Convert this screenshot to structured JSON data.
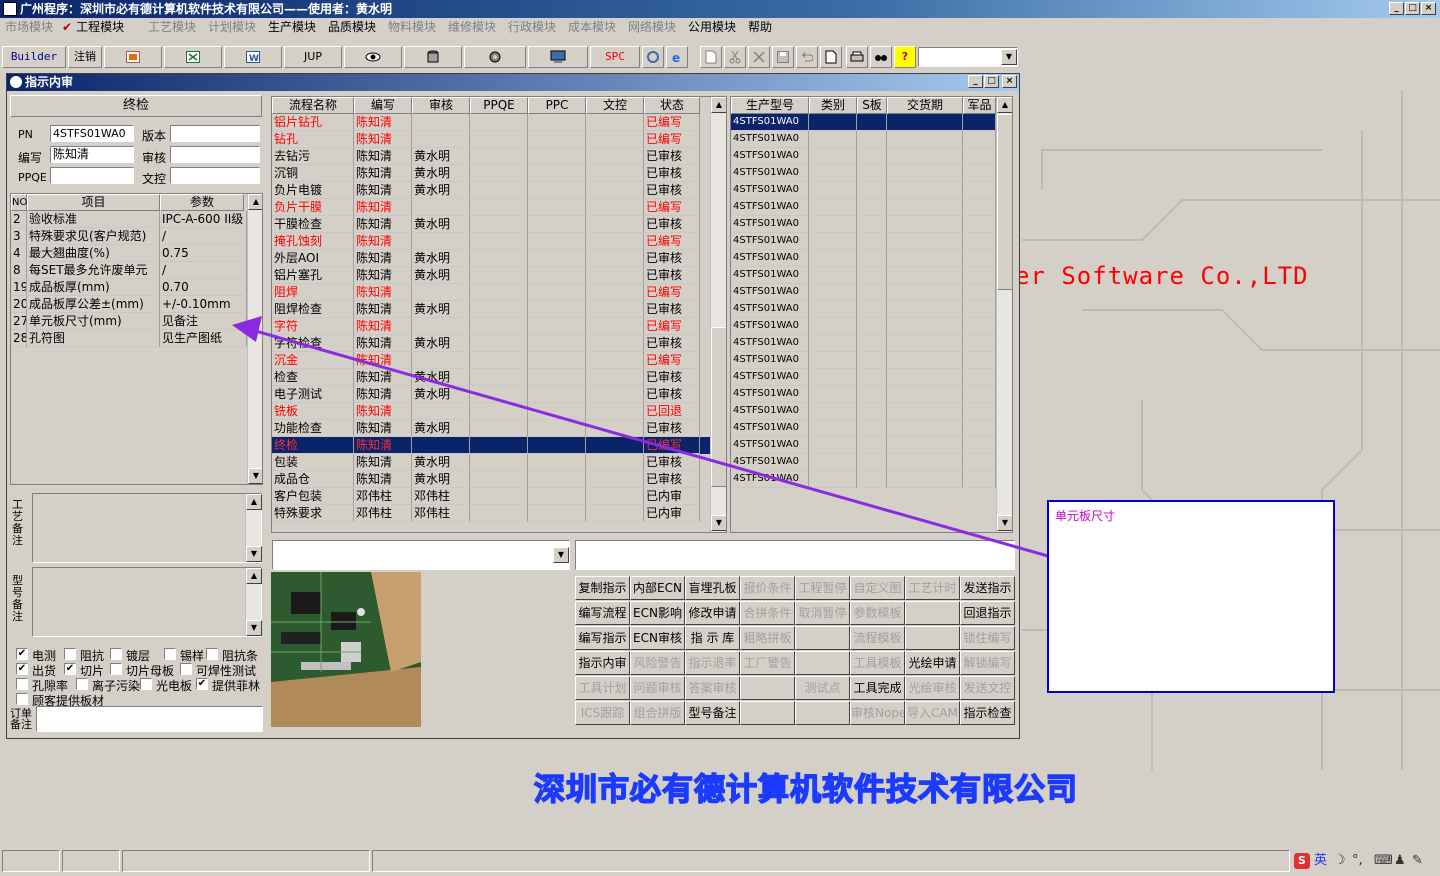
{
  "app": {
    "title": "广州程序：深圳市必有德计算机软件技术有限公司——使用者：黄水明"
  },
  "menu": [
    {
      "label": "市场模块",
      "enabled": false
    },
    {
      "label": "工程模块",
      "enabled": true,
      "checked": true
    },
    {
      "label": "工艺模块",
      "enabled": false
    },
    {
      "label": "计划模块",
      "enabled": false
    },
    {
      "label": "生产模块",
      "enabled": true
    },
    {
      "label": "品质模块",
      "enabled": true
    },
    {
      "label": "物料模块",
      "enabled": false
    },
    {
      "label": "维修模块",
      "enabled": false
    },
    {
      "label": "行政模块",
      "enabled": false
    },
    {
      "label": "成本模块",
      "enabled": false
    },
    {
      "label": "网络模块",
      "enabled": false
    },
    {
      "label": "公用模块",
      "enabled": true
    },
    {
      "label": "帮助",
      "enabled": true
    }
  ],
  "toolbar": {
    "builder": "Builder",
    "logout": "注销",
    "jup": "JUP",
    "spc": "SPC",
    "question": "?"
  },
  "child": {
    "title": "指示内审"
  },
  "left": {
    "section_title": "终检",
    "pn_label": "PN",
    "pn_value": "4STFS01WA0",
    "version_label": "版本",
    "version_value": "",
    "editor_label": "编写",
    "editor_value": "陈知清",
    "review_label": "审核",
    "review_value": "",
    "ppqe_label": "PPQE",
    "ppqe_value": "",
    "wk_label": "文控",
    "wk_value": "",
    "params_headers": {
      "no": "NO",
      "item": "项目",
      "param": "参数"
    },
    "params": [
      {
        "no": "2",
        "item": "验收标准",
        "param": "IPC-A-600 II级"
      },
      {
        "no": "3",
        "item": "特殊要求见(客户规范)",
        "param": "/"
      },
      {
        "no": "4",
        "item": "最大翘曲度(%)",
        "param": "0.75"
      },
      {
        "no": "8",
        "item": "每SET最多允许废单元",
        "param": "/"
      },
      {
        "no": "19",
        "item": "成品板厚(mm)",
        "param": "0.70"
      },
      {
        "no": "20",
        "item": "成品板厚公差±(mm)",
        "param": "+/-0.10mm"
      },
      {
        "no": "27",
        "item": "单元板尺寸(mm)",
        "param": "见备注"
      },
      {
        "no": "28",
        "item": "孔符图",
        "param": "见生产图纸"
      }
    ],
    "craft_note_label": "工艺备注",
    "model_note_label": "型号备注",
    "order_note_label": "订单备注",
    "checks": [
      {
        "label": "电测",
        "checked": true
      },
      {
        "label": "阻抗",
        "checked": false
      },
      {
        "label": "镀层",
        "checked": false
      },
      {
        "label": "锡样",
        "checked": false
      },
      {
        "label": "阻抗条",
        "checked": false
      },
      {
        "label": "出货",
        "checked": true
      },
      {
        "label": "切片",
        "checked": true
      },
      {
        "label": "切片母板",
        "checked": false
      },
      {
        "label": "可焊性测试",
        "checked": false
      },
      {
        "label": "孔隙率",
        "checked": false
      },
      {
        "label": "离子污染",
        "checked": false
      },
      {
        "label": "光电板",
        "checked": false
      },
      {
        "label": "提供菲林",
        "checked": true
      },
      {
        "label": "顾客提供板材",
        "checked": false
      }
    ]
  },
  "process": {
    "headers": [
      "流程名称",
      "编写",
      "审核",
      "PPQE",
      "PPC",
      "文控",
      "状态"
    ],
    "rows": [
      {
        "name": "铝片钻孔",
        "editor": "陈知清",
        "reviewer": "",
        "status": "已编写",
        "red": true
      },
      {
        "name": "钻孔",
        "editor": "陈知清",
        "reviewer": "",
        "status": "已编写",
        "red": true
      },
      {
        "name": "去钻污",
        "editor": "陈知清",
        "reviewer": "黄水明",
        "status": "已审核",
        "red": false
      },
      {
        "name": "沉铜",
        "editor": "陈知清",
        "reviewer": "黄水明",
        "status": "已审核",
        "red": false
      },
      {
        "name": "负片电镀",
        "editor": "陈知清",
        "reviewer": "黄水明",
        "status": "已审核",
        "red": false
      },
      {
        "name": "负片干膜",
        "editor": "陈知清",
        "reviewer": "",
        "status": "已编写",
        "red": true
      },
      {
        "name": "干膜检查",
        "editor": "陈知清",
        "reviewer": "黄水明",
        "status": "已审核",
        "red": false
      },
      {
        "name": "掩孔蚀刻",
        "editor": "陈知清",
        "reviewer": "",
        "status": "已编写",
        "red": true
      },
      {
        "name": "外层AOI",
        "editor": "陈知清",
        "reviewer": "黄水明",
        "status": "已审核",
        "red": false
      },
      {
        "name": "铝片塞孔",
        "editor": "陈知清",
        "reviewer": "黄水明",
        "status": "已审核",
        "red": false
      },
      {
        "name": "阻焊",
        "editor": "陈知清",
        "reviewer": "",
        "status": "已编写",
        "red": true
      },
      {
        "name": "阻焊检查",
        "editor": "陈知清",
        "reviewer": "黄水明",
        "status": "已审核",
        "red": false
      },
      {
        "name": "字符",
        "editor": "陈知清",
        "reviewer": "",
        "status": "已编写",
        "red": true
      },
      {
        "name": "字符检查",
        "editor": "陈知清",
        "reviewer": "黄水明",
        "status": "已审核",
        "red": false
      },
      {
        "name": "沉金",
        "editor": "陈知清",
        "reviewer": "",
        "status": "已编写",
        "red": true
      },
      {
        "name": "检查",
        "editor": "陈知清",
        "reviewer": "黄水明",
        "status": "已审核",
        "red": false
      },
      {
        "name": "电子测试",
        "editor": "陈知清",
        "reviewer": "黄水明",
        "status": "已审核",
        "red": false
      },
      {
        "name": "铣板",
        "editor": "陈知清",
        "reviewer": "",
        "status": "已回退",
        "red": true
      },
      {
        "name": "功能检查",
        "editor": "陈知清",
        "reviewer": "黄水明",
        "status": "已审核",
        "red": false
      },
      {
        "name": "终检",
        "editor": "陈知清",
        "reviewer": "",
        "status": "已编写",
        "red": true,
        "selected": true
      },
      {
        "name": "包装",
        "editor": "陈知清",
        "reviewer": "黄水明",
        "status": "已审核",
        "red": false
      },
      {
        "name": "成品仓",
        "editor": "陈知清",
        "reviewer": "黄水明",
        "status": "已审核",
        "red": false
      },
      {
        "name": "客户包装",
        "editor": "邓伟柱",
        "reviewer": "邓伟柱",
        "status": "已内审",
        "red": false
      },
      {
        "name": "特殊要求",
        "editor": "邓伟柱",
        "reviewer": "邓伟柱",
        "status": "已内审",
        "red": false
      }
    ]
  },
  "models": {
    "headers": [
      "生产型号",
      "类别",
      "S板",
      "交货期",
      "军品"
    ],
    "rows": [
      "4STFS01WA0",
      "4STFS01WA0",
      "4STFS01WA0",
      "4STFS01WA0",
      "4STFS01WA0",
      "4STFS01WA0",
      "4STFS01WA0",
      "4STFS01WA0",
      "4STFS01WA0",
      "4STFS01WA0",
      "4STFS01WA0",
      "4STFS01WA0",
      "4STFS01WA0",
      "4STFS01WA0",
      "4STFS01WA0",
      "4STFS01WA0",
      "4STFS01WA0",
      "4STFS01WA0",
      "4STFS01WA0",
      "4STFS01WA0",
      "4STFS01WA0",
      "4STFS01WA0"
    ]
  },
  "actions": [
    [
      "复制指示",
      "内部ECN",
      "盲埋孔板",
      "报价条件",
      "工程暂停",
      "自定义图",
      "工艺计时",
      "发送指示"
    ],
    [
      "编写流程",
      "ECN影响",
      "修改申请",
      "合拼条件",
      "取消暂停",
      "参数模板",
      "",
      "回退指示"
    ],
    [
      "编写指示",
      "ECN审核",
      "指 示 库",
      "粗略拼板",
      "",
      "流程模板",
      "",
      "锁住编写"
    ],
    [
      "指示内审",
      "风险警告",
      "指示退率",
      "工厂警告",
      "",
      "工具模板",
      "光绘申请",
      "解锁编写"
    ],
    [
      "工具计划",
      "问题审核",
      "答案审核",
      "",
      "测试点",
      "工具完成",
      "光绘审核",
      "发送文控"
    ],
    [
      "ICS跟踪",
      "组合拼版",
      "型号备注",
      "",
      "",
      "审核Nope",
      "导入CAM",
      "指示检查"
    ]
  ],
  "actions_disabled": [
    "报价条件",
    "工程暂停",
    "自定义图",
    "工艺计时",
    "合拼条件",
    "取消暂停",
    "参数模板",
    "粗略拼板",
    "流程模板",
    "锁住编写",
    "风险警告",
    "指示退率",
    "工厂警告",
    "工具模板",
    "解锁编写",
    "工具计划",
    "问题审核",
    "答案审核",
    "测试点",
    "光绘审核",
    "发送文控",
    "ICS跟踪",
    "组合拼版",
    "审核Nope",
    "导入CAM"
  ],
  "callout": {
    "text": "单元板尺寸"
  },
  "background": {
    "company_en": "er Software Co.,LTD",
    "company_cn": "深圳市必有德计算机软件技术有限公司"
  },
  "tray": {
    "ime": "英"
  },
  "colors": {
    "title_dark": "#0a246a",
    "red_text": "#ff0000",
    "arrow": "#8a2be2",
    "callout_border": "#0000cc"
  }
}
